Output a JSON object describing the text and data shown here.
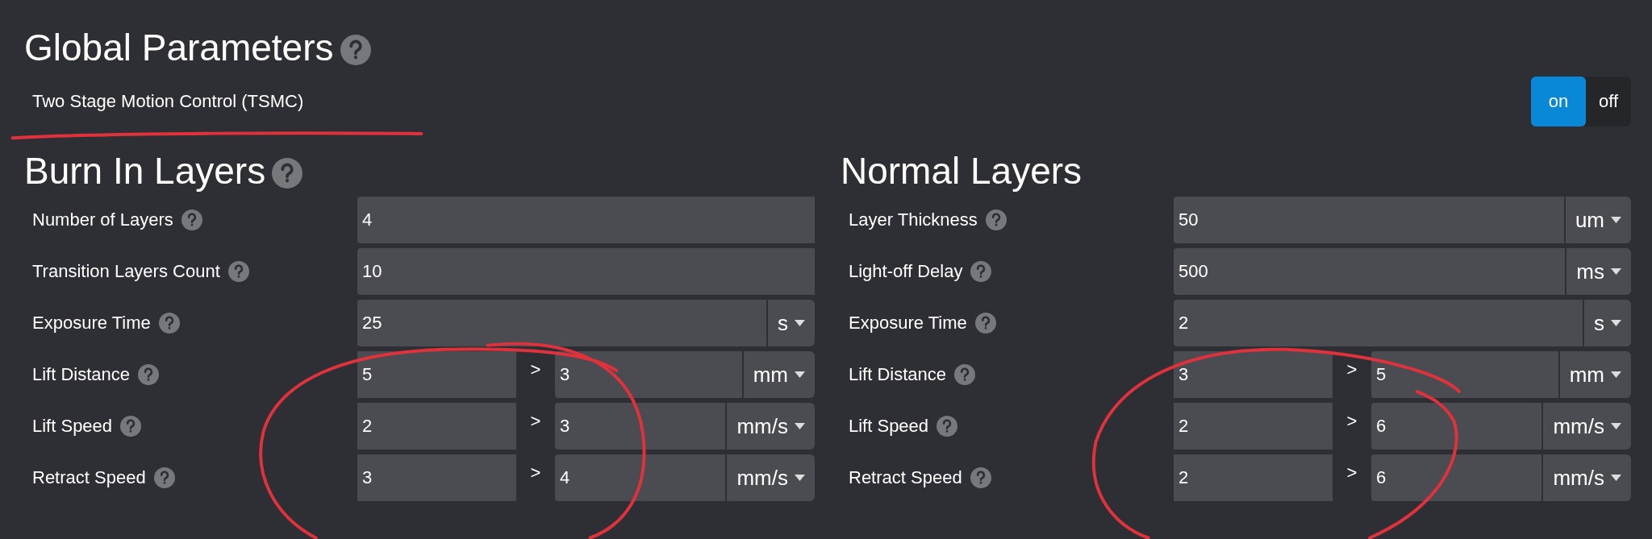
{
  "title": "Global Parameters",
  "title_help": true,
  "tsmc": {
    "label": "Two Stage Motion Control (TSMC)",
    "options": [
      {
        "label": "on",
        "selected": true
      },
      {
        "label": "off",
        "selected": false
      }
    ]
  },
  "sections": [
    {
      "title": "Burn In Layers",
      "help": true,
      "rows": [
        {
          "kind": "plain",
          "label": "Number of Layers",
          "value": "4"
        },
        {
          "kind": "plain",
          "label": "Transition Layers Count",
          "value": "10"
        },
        {
          "kind": "unit",
          "label": "Exposure Time",
          "value": "25",
          "unit": "s"
        },
        {
          "kind": "range",
          "label": "Lift Distance",
          "value": "5",
          "separator": ">",
          "value_to": "3",
          "unit": "mm"
        },
        {
          "kind": "range",
          "label": "Lift Speed",
          "value": "2",
          "separator": ">",
          "value_to": "3",
          "unit": "mm/s"
        },
        {
          "kind": "range",
          "label": "Retract Speed",
          "value": "3",
          "separator": ">",
          "value_to": "4",
          "unit": "mm/s"
        }
      ]
    },
    {
      "title": "Normal Layers",
      "help": false,
      "rows": [
        {
          "kind": "unit",
          "label": "Layer Thickness",
          "value": "50",
          "unit": "um"
        },
        {
          "kind": "unit",
          "label": "Light-off Delay",
          "value": "500",
          "unit": "ms"
        },
        {
          "kind": "unit",
          "label": "Exposure Time",
          "value": "2",
          "unit": "s"
        },
        {
          "kind": "range",
          "label": "Lift Distance",
          "value": "3",
          "separator": ">",
          "value_to": "5",
          "unit": "mm"
        },
        {
          "kind": "range",
          "label": "Lift Speed",
          "value": "2",
          "separator": ">",
          "value_to": "6",
          "unit": "mm/s"
        },
        {
          "kind": "range",
          "label": "Retract Speed",
          "value": "2",
          "separator": ">",
          "value_to": "6",
          "unit": "mm/s"
        }
      ]
    }
  ]
}
